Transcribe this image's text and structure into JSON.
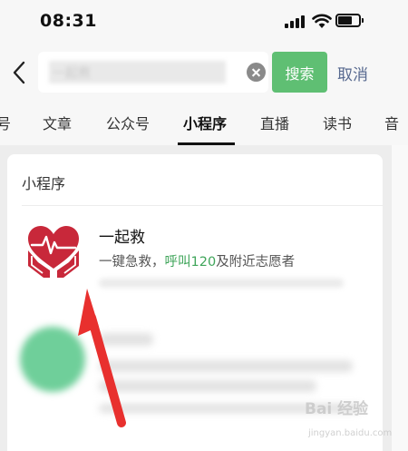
{
  "status_bar": {
    "time": "08:31"
  },
  "search": {
    "query": "一起救",
    "search_label": "搜索",
    "cancel_label": "取消"
  },
  "tabs": [
    {
      "label": "号"
    },
    {
      "label": "文章"
    },
    {
      "label": "公众号"
    },
    {
      "label": "小程序",
      "active": true
    },
    {
      "label": "直播"
    },
    {
      "label": "读书"
    },
    {
      "label": "音"
    }
  ],
  "section": {
    "title": "小程序"
  },
  "results": [
    {
      "name": "一起救",
      "desc_prefix": "一键急救，",
      "desc_highlight": "呼叫120",
      "desc_suffix": "及附近志愿者",
      "icon": "heart-hands-icon"
    }
  ],
  "watermark": {
    "text": "Bai 经验",
    "sub": "jingyan.baidu.com"
  },
  "colors": {
    "accent": "#5fbf73",
    "highlight": "#3fa55a",
    "cancel": "#57698f",
    "logo": "#c8283a",
    "arrow": "#e8302e"
  }
}
